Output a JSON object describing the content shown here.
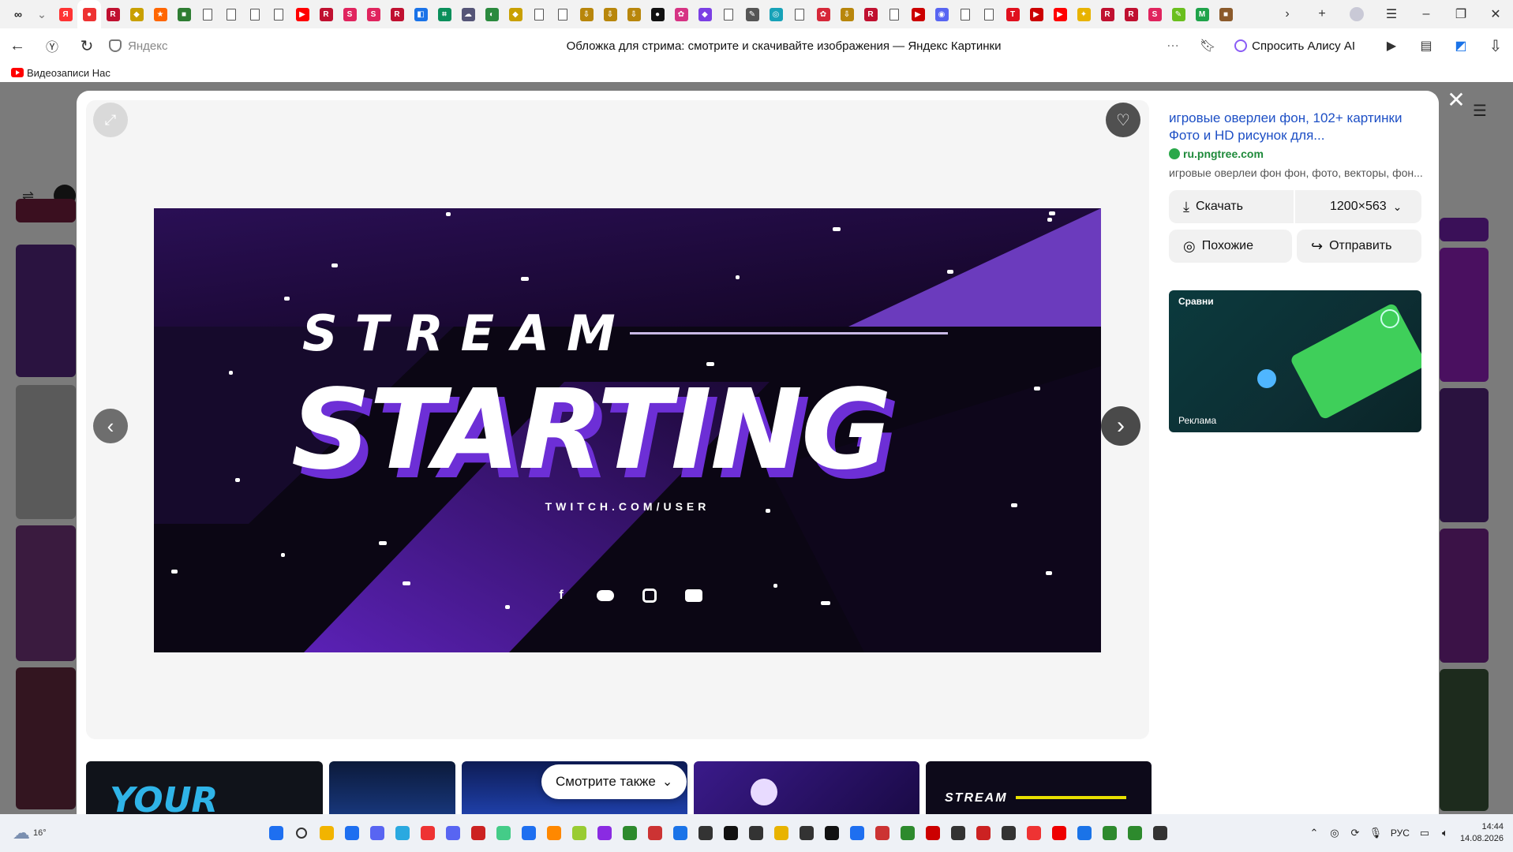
{
  "browser": {
    "tab_icons": [
      {
        "name": "infinity",
        "color": "#222",
        "glyph": "∞"
      },
      {
        "name": "chevron",
        "color": "#888",
        "glyph": "⌄"
      },
      {
        "name": "yandex",
        "color": "#f33",
        "glyph": "Я"
      },
      {
        "name": "active-image",
        "color": "#e33",
        "glyph": "●"
      },
      {
        "name": "r-app",
        "color": "#c01030",
        "glyph": "R"
      },
      {
        "name": "shield",
        "color": "#c9a000",
        "glyph": "◆"
      },
      {
        "name": "orange",
        "color": "#f60",
        "glyph": "★"
      },
      {
        "name": "box",
        "color": "#2e7d32",
        "glyph": "■"
      },
      {
        "name": "doc",
        "color": "#fff",
        "glyph": ""
      },
      {
        "name": "doc",
        "color": "#fff",
        "glyph": ""
      },
      {
        "name": "doc",
        "color": "#fff",
        "glyph": ""
      },
      {
        "name": "doc",
        "color": "#fff",
        "glyph": ""
      },
      {
        "name": "yt",
        "color": "#f00",
        "glyph": "▶"
      },
      {
        "name": "r-app",
        "color": "#c01030",
        "glyph": "R"
      },
      {
        "name": "s-app",
        "color": "#e0245e",
        "glyph": "S"
      },
      {
        "name": "s-app",
        "color": "#e0245e",
        "glyph": "S"
      },
      {
        "name": "r-app",
        "color": "#c01030",
        "glyph": "R"
      },
      {
        "name": "blue",
        "color": "#1a73e8",
        "glyph": "◧"
      },
      {
        "name": "green",
        "color": "#0a8f5b",
        "glyph": "⌗"
      },
      {
        "name": "cloud",
        "color": "#557",
        "glyph": "☁"
      },
      {
        "name": "melon",
        "color": "#2b8a3e",
        "glyph": "◐"
      },
      {
        "name": "shield",
        "color": "#c9a000",
        "glyph": "◆"
      },
      {
        "name": "doc",
        "color": "#fff",
        "glyph": ""
      },
      {
        "name": "doc",
        "color": "#fff",
        "glyph": ""
      },
      {
        "name": "down",
        "color": "#b8860b",
        "glyph": "⇩"
      },
      {
        "name": "down",
        "color": "#b8860b",
        "glyph": "⇩"
      },
      {
        "name": "down",
        "color": "#b8860b",
        "glyph": "⇩"
      },
      {
        "name": "circle",
        "color": "#111",
        "glyph": "●"
      },
      {
        "name": "pink",
        "color": "#d63384",
        "glyph": "✿"
      },
      {
        "name": "purple",
        "color": "#7b3fe4",
        "glyph": "◆"
      },
      {
        "name": "doc",
        "color": "#fff",
        "glyph": ""
      },
      {
        "name": "pen",
        "color": "#555",
        "glyph": "✎"
      },
      {
        "name": "cyan",
        "color": "#17a2b8",
        "glyph": "◎"
      },
      {
        "name": "doc",
        "color": "#fff",
        "glyph": ""
      },
      {
        "name": "red-flower",
        "color": "#d62839",
        "glyph": "✿"
      },
      {
        "name": "down",
        "color": "#b8860b",
        "glyph": "⇩"
      },
      {
        "name": "r-app",
        "color": "#c01030",
        "glyph": "R"
      },
      {
        "name": "doc",
        "color": "#fff",
        "glyph": ""
      },
      {
        "name": "play",
        "color": "#c00",
        "glyph": "▶"
      },
      {
        "name": "discord",
        "color": "#5865f2",
        "glyph": "◉"
      },
      {
        "name": "doc",
        "color": "#fff",
        "glyph": ""
      },
      {
        "name": "doc",
        "color": "#fff",
        "glyph": ""
      },
      {
        "name": "t-app",
        "color": "#e0101e",
        "glyph": "T"
      },
      {
        "name": "play",
        "color": "#c00",
        "glyph": "▶"
      },
      {
        "name": "yt",
        "color": "#f00",
        "glyph": "▶"
      },
      {
        "name": "runner",
        "color": "#e8b300",
        "glyph": "✦"
      },
      {
        "name": "r-app",
        "color": "#c01030",
        "glyph": "R"
      },
      {
        "name": "r-app",
        "color": "#c01030",
        "glyph": "R"
      },
      {
        "name": "s-app",
        "color": "#e0245e",
        "glyph": "S"
      },
      {
        "name": "brush",
        "color": "#6abf1e",
        "glyph": "✎"
      },
      {
        "name": "m-app",
        "color": "#1fa34a",
        "glyph": "M"
      },
      {
        "name": "craft",
        "color": "#8b5a2b",
        "glyph": "■"
      }
    ],
    "address_host": "Яндекс",
    "page_title": "Обложка для стрима: смотрите и скачивайте изображения — Яндекс Картинки",
    "alice_label": "Спросить Алису AI",
    "bookmark_label": "Видеозаписи Нас"
  },
  "viewer": {
    "banner": {
      "line1": "STREAM",
      "line2": "STARTING",
      "subline": "TWITCH.COM/USER",
      "socials": [
        "f",
        "discord",
        "instagram",
        "youtube"
      ]
    }
  },
  "sidebar": {
    "title": "игровые оверлеи фон, 102+ картинки Фото и HD рисунок для...",
    "source": "ru.pngtree.com",
    "description": "игровые оверлеи фон фон, фото, векторы, фон...",
    "download_label": "Скачать",
    "size_label": "1200×563",
    "similar_label": "Похожие",
    "share_label": "Отправить",
    "ad": {
      "brand": "Сравни",
      "label": "Реклама"
    }
  },
  "see_also_label": "Смотрите также",
  "taskbar": {
    "temperature": "16°",
    "language": "РУС",
    "time": "14:44",
    "date": "14.08.2026"
  }
}
